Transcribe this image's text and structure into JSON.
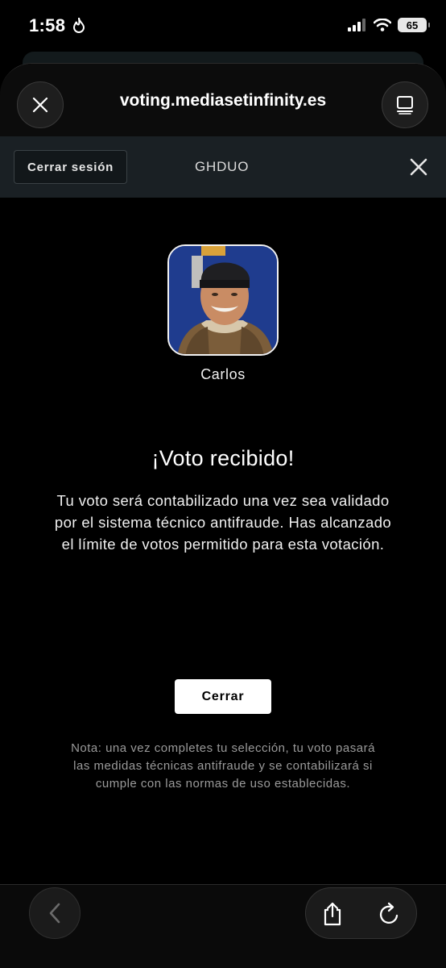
{
  "status_bar": {
    "time": "1:58",
    "battery": "65",
    "icons": [
      "flame-icon",
      "signal-icon",
      "wifi-icon",
      "battery-icon"
    ]
  },
  "browser": {
    "url": "voting.mediasetinfinity.es",
    "icons": [
      "close-icon",
      "tab-overview-icon",
      "back-icon",
      "share-icon",
      "reload-icon"
    ]
  },
  "site_bar": {
    "logout_label": "Cerrar sesión",
    "user_code": "GHDUO",
    "close_icon": "close-icon"
  },
  "candidate": {
    "name": "Carlos"
  },
  "result": {
    "title": "¡Voto recibido!",
    "message": "Tu voto será contabilizado una vez sea validado por el sistema técnico antifraude. Has alcanzado el límite de votos permitido para esta votación.",
    "close_label": "Cerrar",
    "note": "Nota: una vez completes tu selección, tu voto pasará las medidas técnicas antifraude y se contabilizará si cumple con las normas de uso establecidas."
  },
  "colors": {
    "background": "#000000",
    "site_bar": "#1a2024",
    "primary_button": "#ffffff",
    "note_text": "#9a9a9a",
    "avatar_backdrop": "#1f3c8e"
  }
}
